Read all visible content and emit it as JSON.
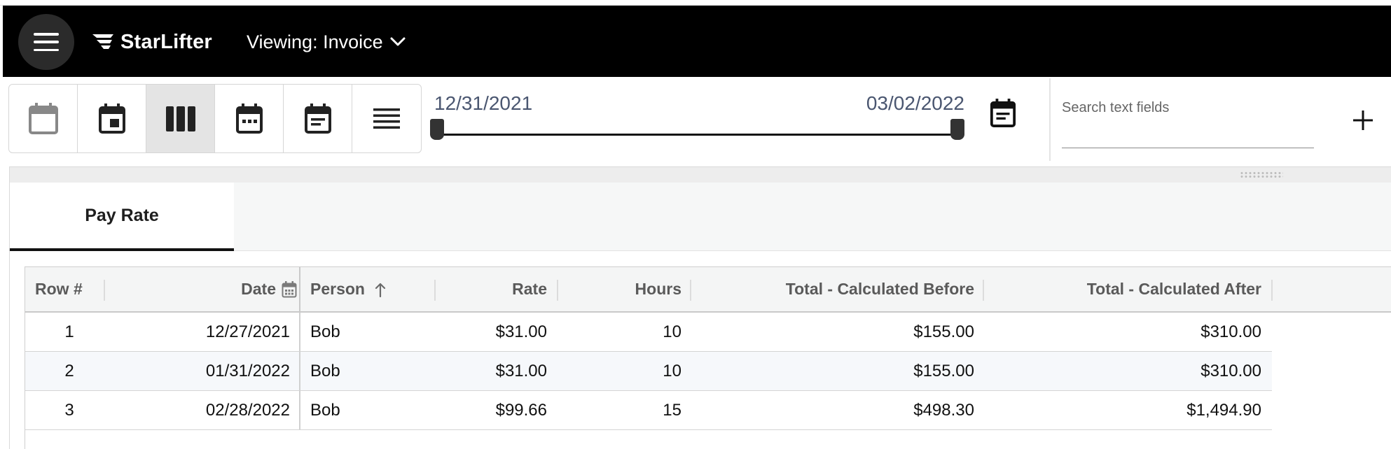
{
  "app": {
    "logo_text": "StarLifter",
    "viewing_label": "Viewing: Invoice"
  },
  "toolbar": {
    "view_buttons": [
      {
        "name": "calendar-blank-icon",
        "active": false
      },
      {
        "name": "calendar-today-icon",
        "active": false
      },
      {
        "name": "view-column-icon",
        "active": true
      },
      {
        "name": "calendar-month-icon",
        "active": false
      },
      {
        "name": "calendar-text-icon",
        "active": false
      },
      {
        "name": "list-lines-icon",
        "active": false
      }
    ],
    "date_range": {
      "start": "12/31/2021",
      "end": "03/02/2022"
    },
    "search": {
      "placeholder": "Search text fields",
      "value": ""
    }
  },
  "tabs": [
    {
      "label": "Pay Rate",
      "active": true
    }
  ],
  "table": {
    "columns": [
      {
        "label": "Row #"
      },
      {
        "label": "Date"
      },
      {
        "label": "Person",
        "sort": "ascending"
      },
      {
        "label": "Rate"
      },
      {
        "label": "Hours"
      },
      {
        "label": "Total - Calculated Before"
      },
      {
        "label": "Total - Calculated After"
      }
    ],
    "rows": [
      [
        "1",
        "12/27/2021",
        "Bob",
        "$31.00",
        "10",
        "$155.00",
        "$310.00"
      ],
      [
        "2",
        "01/31/2022",
        "Bob",
        "$31.00",
        "10",
        "$155.00",
        "$310.00"
      ],
      [
        "3",
        "02/28/2022",
        "Bob",
        "$99.66",
        "15",
        "$498.30",
        "$1,494.90"
      ]
    ]
  },
  "colors": {
    "appbar": "#000000",
    "date_text": "#4a5670",
    "active_view": "#e4e4e4"
  }
}
